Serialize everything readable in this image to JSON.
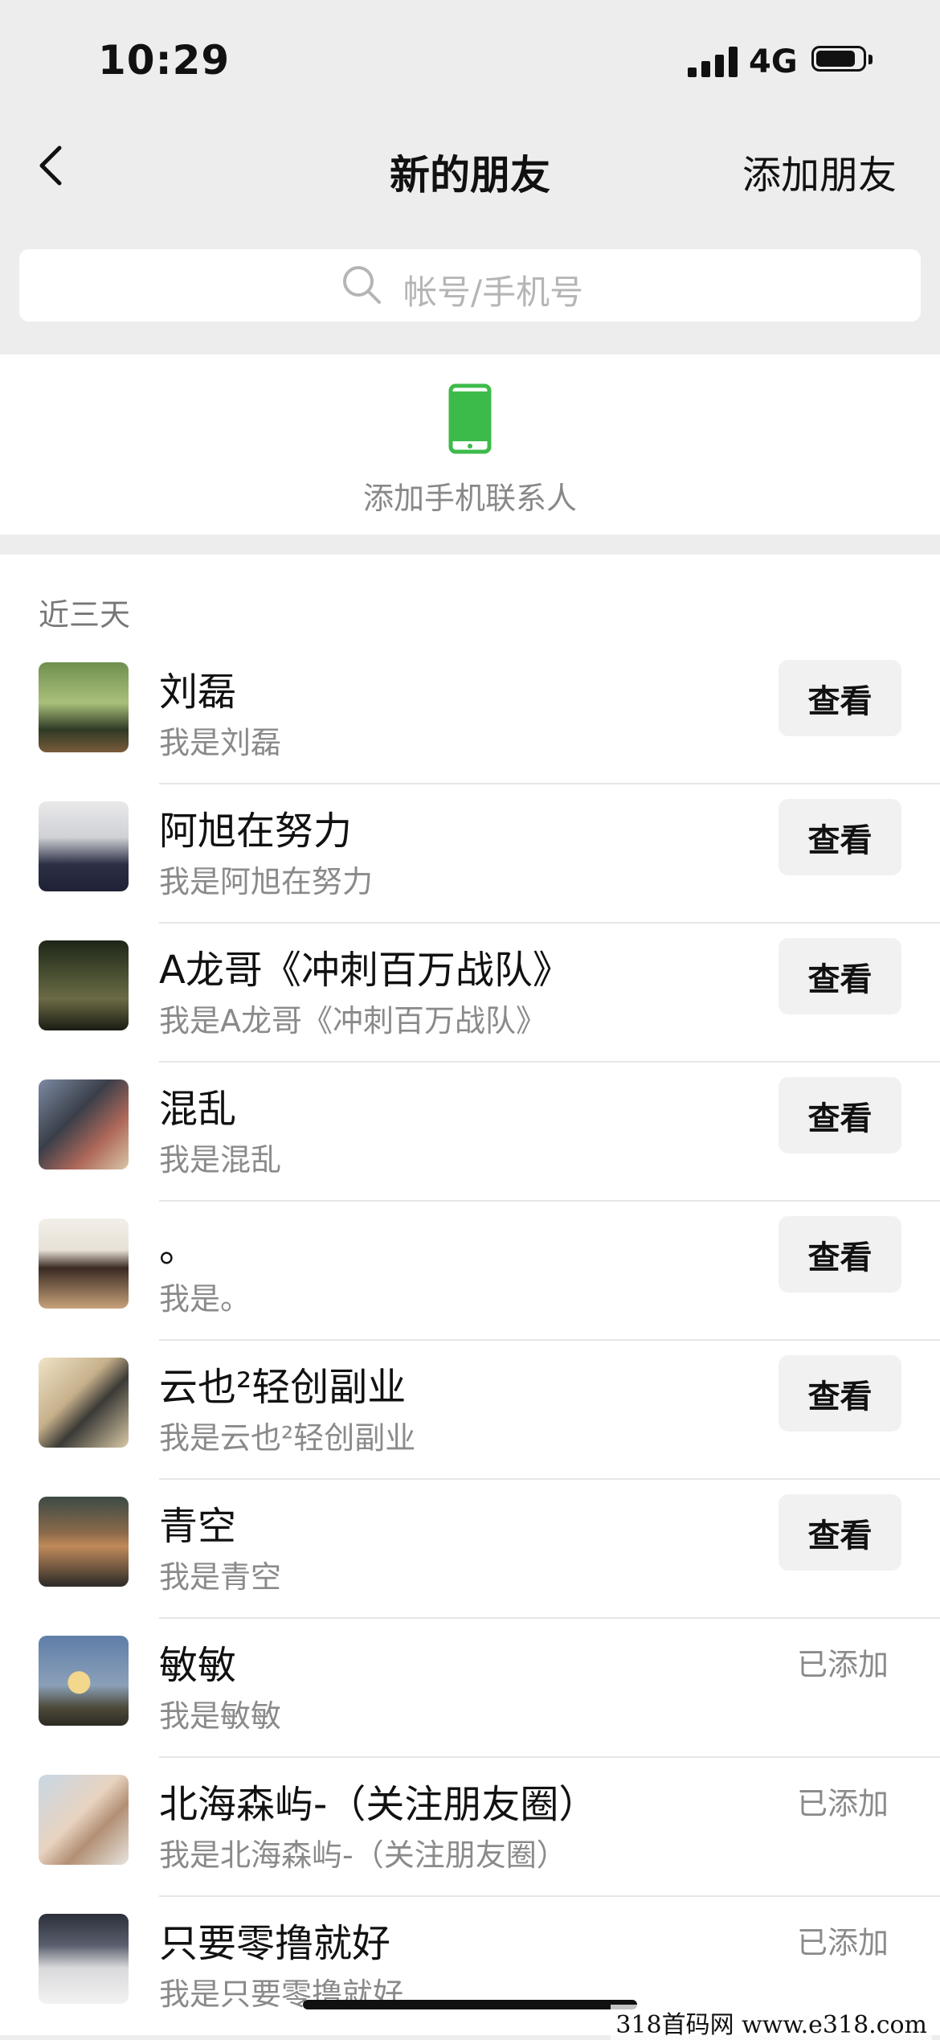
{
  "status_bar": {
    "time": "10:29",
    "network": "4G"
  },
  "nav": {
    "title": "新的朋友",
    "add_label": "添加朋友"
  },
  "search": {
    "placeholder": "帐号/手机号"
  },
  "phone_contacts": {
    "label": "添加手机联系人"
  },
  "section": {
    "title": "近三天"
  },
  "friends": [
    {
      "name": "刘磊",
      "message": "我是刘磊",
      "action": "查看",
      "status": ""
    },
    {
      "name": "阿旭在努力",
      "message": "我是阿旭在努力",
      "action": "查看",
      "status": ""
    },
    {
      "name": "A龙哥《冲刺百万战队》",
      "message": "我是A龙哥《冲刺百万战队》",
      "action": "查看",
      "status": ""
    },
    {
      "name": "混乱",
      "message": "我是混乱",
      "action": "查看",
      "status": ""
    },
    {
      "name": "。",
      "message": "我是。",
      "action": "查看",
      "status": ""
    },
    {
      "name": "云也²轻创副业",
      "message": "我是云也²轻创副业",
      "action": "查看",
      "status": ""
    },
    {
      "name": "青空",
      "message": "我是青空",
      "action": "查看",
      "status": ""
    },
    {
      "name": "敏敏",
      "message": "我是敏敏",
      "action": "",
      "status": "已添加"
    },
    {
      "name": "北海森屿-（关注朋友圈）",
      "message": "我是北海森屿-（关注朋友圈）",
      "action": "",
      "status": "已添加"
    },
    {
      "name": "只要零撸就好",
      "message": "我是只要零撸就好",
      "action": "",
      "status": "已添加"
    }
  ],
  "watermark": "318首码网 www.e318.com",
  "colors": {
    "accent_green": "#3dbb4a",
    "background": "#ededed",
    "secondary_text": "#8a8a8a"
  },
  "icons": [
    "back-chevron-icon",
    "search-icon",
    "phone-icon",
    "signal-icon",
    "battery-icon"
  ]
}
